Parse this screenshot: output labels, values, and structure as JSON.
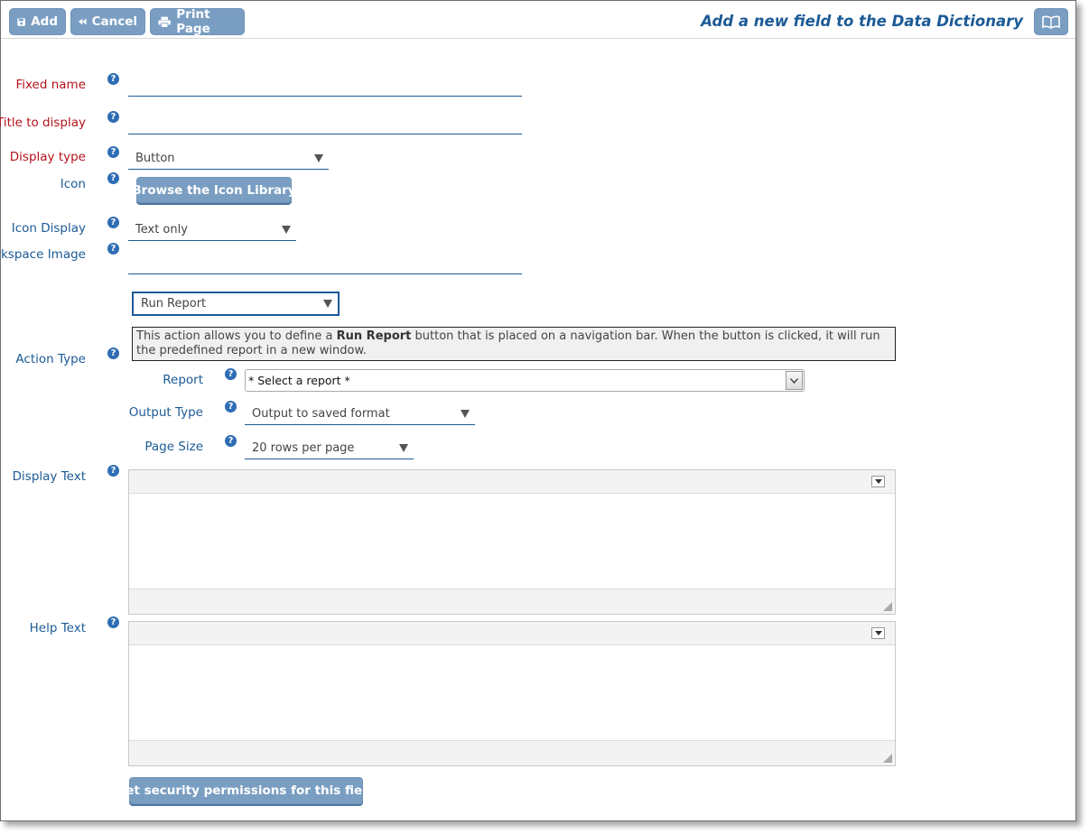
{
  "toolbar": {
    "add_label": "Add",
    "cancel_label": "Cancel",
    "print_label": "Print Page"
  },
  "header": {
    "title": "Add a new field to the Data Dictionary"
  },
  "form": {
    "fixed_name": {
      "label": "Fixed name",
      "value": ""
    },
    "title_to_display": {
      "label": "Title to display",
      "value": ""
    },
    "display_type": {
      "label": "Display type",
      "value": "Button"
    },
    "icon": {
      "label": "Icon",
      "button_label": "Browse the Icon Library"
    },
    "icon_display": {
      "label": "Icon Display",
      "value": "Text only"
    },
    "workspace_image": {
      "label": "Workspace Image",
      "value": ""
    },
    "action_type": {
      "label": "Action Type",
      "value": "Run Report",
      "desc_pre": "This action allows you to define a ",
      "desc_bold": "Run Report",
      "desc_post": " button that is placed on a navigation bar. When the button is clicked, it will run the predefined report in a new window."
    },
    "report": {
      "label": "Report",
      "value": "* Select a report *"
    },
    "output_type": {
      "label": "Output Type",
      "value": "Output to saved format"
    },
    "page_size": {
      "label": "Page Size",
      "value": "20 rows per page"
    },
    "display_text": {
      "label": "Display Text"
    },
    "help_text": {
      "label": "Help Text"
    },
    "security_button": "Set security permissions for this field"
  },
  "help_glyph": "?",
  "colors": {
    "accent": "#7a9ec2",
    "required_label": "#b5121b",
    "optional_label": "#1c5a96",
    "help_icon": "#2e6db4"
  }
}
